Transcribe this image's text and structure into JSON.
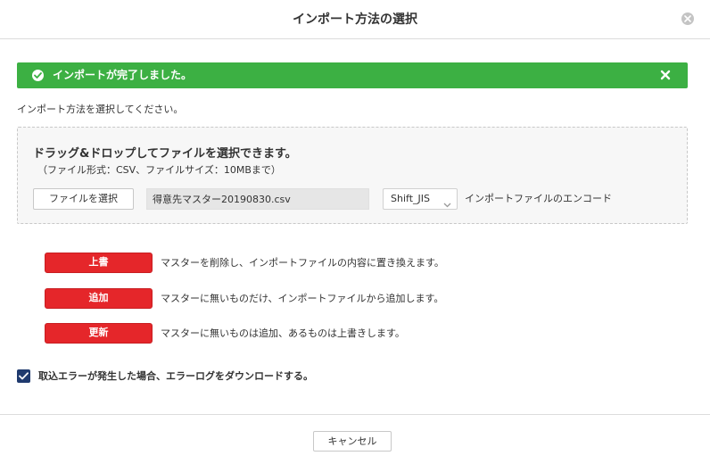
{
  "dialog": {
    "title": "インポート方法の選択",
    "close_icon": "close-circle-icon"
  },
  "alert": {
    "message": "インポートが完了しました。",
    "status_icon": "check-circle-icon",
    "dismiss_icon": "close-icon",
    "color": "#3cb043"
  },
  "instruction": "インポート方法を選択してください。",
  "dropzone": {
    "title": "ドラッグ&ドロップしてファイルを選択できます。",
    "subtitle": "（ファイル形式：CSV、ファイルサイズ：10MBまで）",
    "choose_label": "ファイルを選択",
    "filename": "得意先マスター20190830.csv",
    "encoding_value": "Shift_JIS",
    "encoding_label": "インポートファイルのエンコード"
  },
  "actions": [
    {
      "label": "上書",
      "description": "マスターを削除し、インポートファイルの内容に置き換えます。"
    },
    {
      "label": "追加",
      "description": "マスターに無いものだけ、インポートファイルから追加します。"
    },
    {
      "label": "更新",
      "description": "マスターに無いものは追加、あるものは上書きします。"
    }
  ],
  "action_color": "#e5262a",
  "error_log_option": {
    "label": "取込エラーが発生した場合、エラーログをダウンロードする。",
    "checked": true
  },
  "footer": {
    "cancel_label": "キャンセル"
  }
}
